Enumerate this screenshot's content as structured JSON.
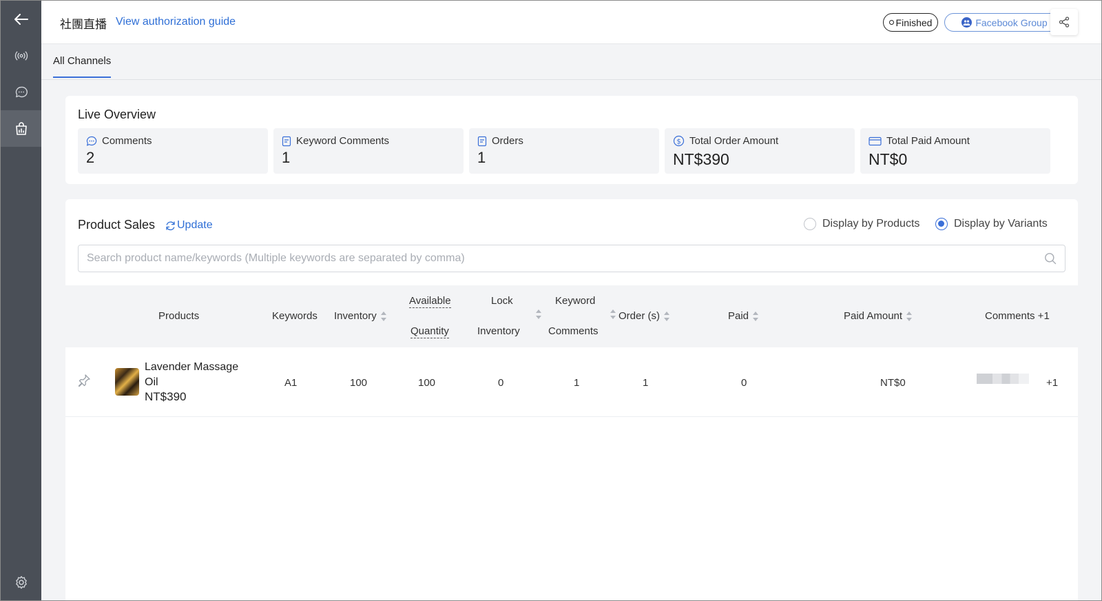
{
  "header": {
    "title": "社團直播",
    "guide_link": "View authorization guide",
    "status_badge": "Finished",
    "source_badge": "Facebook Group"
  },
  "tabs": [
    {
      "label": "All Channels",
      "active": true
    }
  ],
  "overview": {
    "title": "Live Overview",
    "stats": [
      {
        "label": "Comments",
        "value": "2",
        "icon": "comment-icon"
      },
      {
        "label": "Keyword Comments",
        "value": "1",
        "icon": "document-icon"
      },
      {
        "label": "Orders",
        "value": "1",
        "icon": "document-icon"
      },
      {
        "label": "Total Order Amount",
        "value": "NT$390",
        "icon": "dollar-icon"
      },
      {
        "label": "Total Paid Amount",
        "value": "NT$0",
        "icon": "card-icon"
      }
    ]
  },
  "sales": {
    "title": "Product Sales",
    "update_label": "Update",
    "display_options": [
      {
        "label": "Display by Products",
        "selected": false
      },
      {
        "label": "Display by Variants",
        "selected": true
      }
    ],
    "search_placeholder": "Search product name/keywords (Multiple keywords are separated by comma)",
    "columns": {
      "products": "Products",
      "keywords": "Keywords",
      "inventory": "Inventory",
      "available_1": "Available",
      "available_2": "Quantity",
      "lock_1": "Lock",
      "lock_2": "Inventory",
      "kwc_1": "Keyword",
      "kwc_2": "Comments",
      "orders": "Order (s)",
      "paid": "Paid",
      "paid_amount": "Paid Amount",
      "comments": "Comments +1"
    },
    "rows": [
      {
        "product_name": "Lavender Massage Oil",
        "price": "NT$390",
        "keyword": "A1",
        "inventory": "100",
        "available": "100",
        "lock_inventory": "0",
        "keyword_comments": "1",
        "orders": "1",
        "paid": "0",
        "paid_amount": "NT$0",
        "comments_plus": "+1"
      }
    ]
  },
  "colors": {
    "sidebar": "#4a4f57",
    "accent": "#3a6fd8",
    "link": "#2f6fd6"
  }
}
